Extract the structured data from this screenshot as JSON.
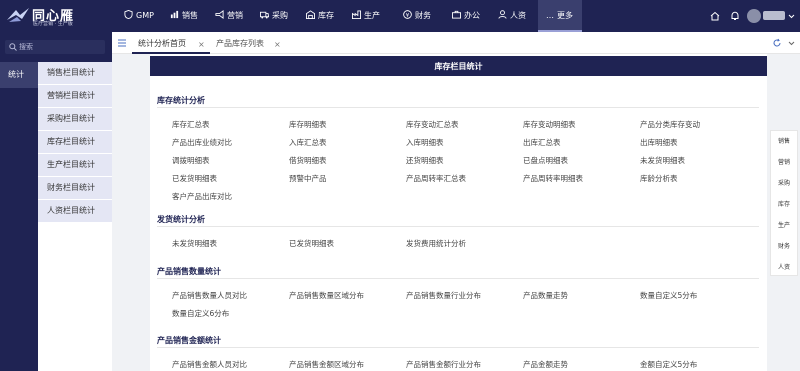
{
  "brand": {
    "name": "同心雁",
    "subtitle": "医疗营销 · 生产版"
  },
  "nav": {
    "items": [
      {
        "label": "GMP",
        "icon": "shield-icon"
      },
      {
        "label": "销售",
        "icon": "bar-chart-icon"
      },
      {
        "label": "营销",
        "icon": "megaphone-icon"
      },
      {
        "label": "采购",
        "icon": "truck-icon"
      },
      {
        "label": "库存",
        "icon": "warehouse-icon"
      },
      {
        "label": "生产",
        "icon": "factory-icon"
      },
      {
        "label": "财务",
        "icon": "coin-icon"
      },
      {
        "label": "办公",
        "icon": "briefcase-icon"
      },
      {
        "label": "人资",
        "icon": "person-icon"
      },
      {
        "label": "更多",
        "icon": "ellipsis-icon"
      }
    ],
    "active_index": 9
  },
  "topright": {
    "icons": [
      "home-icon",
      "bell-icon",
      "avatar",
      "chevron-down-icon"
    ]
  },
  "sidebar": {
    "search_placeholder": "搜索",
    "category_label": "统计",
    "menu": [
      "销售栏目统计",
      "营销栏目统计",
      "采购栏目统计",
      "库存栏目统计",
      "生产栏目统计",
      "财务栏目统计",
      "人资栏目统计"
    ]
  },
  "tabs": {
    "items": [
      {
        "label": "统计分析首页",
        "active": true
      },
      {
        "label": "产品库存列表",
        "active": false
      }
    ],
    "close_glyph": "×"
  },
  "main": {
    "title": "库存栏目统计",
    "sections": [
      {
        "title": "库存统计分析",
        "links": [
          "库存汇总表",
          "库存明细表",
          "库存变动汇总表",
          "库存变动明细表",
          "产品分类库存变动",
          "产品出库业绩对比",
          "入库汇总表",
          "入库明细表",
          "出库汇总表",
          "出库明细表",
          "调拨明细表",
          "借货明细表",
          "还货明细表",
          "已盘点明细表",
          "未发货明细表",
          "已发货明细表",
          "预警中产品",
          "产品周转率汇总表",
          "产品周转率明细表",
          "库龄分析表",
          "客户产品出库对比"
        ]
      },
      {
        "title": "发货统计分析",
        "links": [
          "未发货明细表",
          "已发货明细表",
          "发货费用统计分析"
        ]
      },
      {
        "title": "产品销售数量统计",
        "links": [
          "产品销售数量人员对比",
          "产品销售数量区域分布",
          "产品销售数量行业分布",
          "产品数量走势",
          "数量自定义5分布",
          "数量自定义6分布"
        ]
      },
      {
        "title": "产品销售金额统计",
        "links": [
          "产品销售金额人员对比",
          "产品销售金额区域分布",
          "产品销售金额行业分布",
          "产品金额走势",
          "金额自定义5分布"
        ]
      }
    ]
  },
  "rightnav": {
    "items": [
      "销售",
      "营销",
      "采购",
      "库存",
      "生产",
      "财务",
      "人资"
    ]
  }
}
